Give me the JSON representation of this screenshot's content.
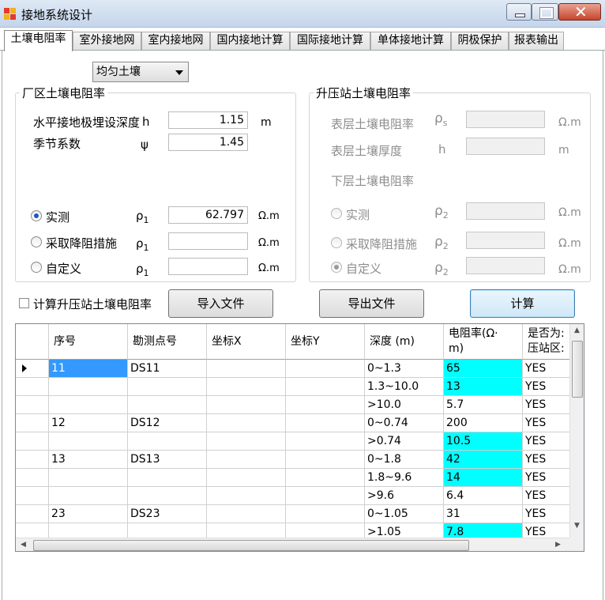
{
  "window": {
    "title": "接地系统设计"
  },
  "tabs": [
    "土壤电阻率",
    "室外接地网",
    "室内接地网",
    "国内接地计算",
    "国际接地计算",
    "单体接地计算",
    "阴极保护",
    "报表输出"
  ],
  "soil_type": {
    "selected": "均匀土壤"
  },
  "plant": {
    "title": "厂区土壤电阻率",
    "depth_label": "水平接地极埋设深度",
    "depth_symbol": "h",
    "depth_value": "1.15",
    "depth_unit": "m",
    "season_label": "季节系数",
    "season_symbol": "ψ",
    "season_value": "1.45",
    "options": [
      {
        "label": "实测",
        "symbol": "ρ",
        "sub": "1",
        "value": "62.797",
        "unit": "Ω.m",
        "selected": true
      },
      {
        "label": "采取降阻措施",
        "symbol": "ρ",
        "sub": "1",
        "value": "",
        "unit": "Ω.m",
        "selected": false
      },
      {
        "label": "自定义",
        "symbol": "ρ",
        "sub": "1",
        "value": "",
        "unit": "Ω.m",
        "selected": false
      }
    ]
  },
  "substation": {
    "title": "升压站土壤电阻率",
    "surface_label": "表层土壤电阻率",
    "surface_symbol": "ρ",
    "surface_sub": "s",
    "surface_unit": "Ω.m",
    "thickness_label": "表层土壤厚度",
    "thickness_symbol": "h",
    "thickness_unit": "m",
    "lower_label": "下层土壤电阻率",
    "options": [
      {
        "label": "实测",
        "symbol": "ρ",
        "sub": "2",
        "unit": "Ω.m",
        "selected": false
      },
      {
        "label": "采取降阻措施",
        "symbol": "ρ",
        "sub": "2",
        "unit": "Ω.m",
        "selected": false
      },
      {
        "label": "自定义",
        "symbol": "ρ",
        "sub": "2",
        "unit": "Ω.m",
        "selected": true
      }
    ]
  },
  "actions": {
    "calc_sub_checkbox": "计算升压站土壤电阻率",
    "import": "导入文件",
    "export": "导出文件",
    "calculate": "计算"
  },
  "grid": {
    "headers": [
      "序号",
      "勘测点号",
      "坐标X",
      "坐标Y",
      "深度 (m)",
      "电阻率(Ω·m)",
      "是否为升压站区"
    ],
    "header_display": [
      "序号",
      "勘测点号",
      "坐标X",
      "坐标Y",
      "深度 (m)",
      "电阻率(Ω·\nm)",
      "是否为:\n压站区:"
    ],
    "highlight_color": "#00ffff",
    "rows": [
      {
        "no": "11",
        "point": "DS11",
        "x": "",
        "y": "",
        "depth": "0~1.3",
        "rho": "65",
        "sub": "YES",
        "hl": true,
        "current": true
      },
      {
        "no": "",
        "point": "",
        "x": "",
        "y": "",
        "depth": "1.3~10.0",
        "rho": "13",
        "sub": "YES",
        "hl": true
      },
      {
        "no": "",
        "point": "",
        "x": "",
        "y": "",
        "depth": ">10.0",
        "rho": "5.7",
        "sub": "YES",
        "hl": false
      },
      {
        "no": "12",
        "point": "DS12",
        "x": "",
        "y": "",
        "depth": "0~0.74",
        "rho": "200",
        "sub": "YES",
        "hl": false
      },
      {
        "no": "",
        "point": "",
        "x": "",
        "y": "",
        "depth": ">0.74",
        "rho": "10.5",
        "sub": "YES",
        "hl": true
      },
      {
        "no": "13",
        "point": "DS13",
        "x": "",
        "y": "",
        "depth": "0~1.8",
        "rho": "42",
        "sub": "YES",
        "hl": true
      },
      {
        "no": "",
        "point": "",
        "x": "",
        "y": "",
        "depth": "1.8~9.6",
        "rho": "14",
        "sub": "YES",
        "hl": true
      },
      {
        "no": "",
        "point": "",
        "x": "",
        "y": "",
        "depth": ">9.6",
        "rho": "6.4",
        "sub": "YES",
        "hl": false
      },
      {
        "no": "23",
        "point": "DS23",
        "x": "",
        "y": "",
        "depth": "0~1.05",
        "rho": "31",
        "sub": "YES",
        "hl": false
      },
      {
        "no": "",
        "point": "",
        "x": "",
        "y": "",
        "depth": ">1.05",
        "rho": "7.8",
        "sub": "YES",
        "hl": true
      }
    ]
  }
}
